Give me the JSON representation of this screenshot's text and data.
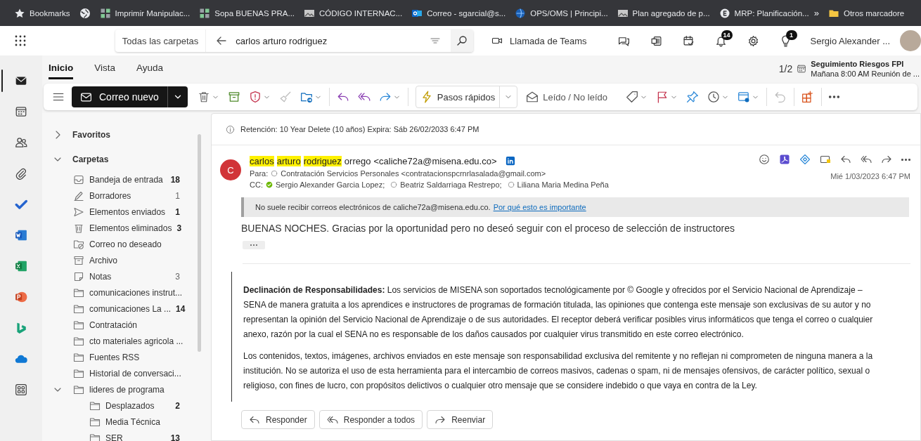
{
  "bookmarks_bar": {
    "items": [
      {
        "label": "Bookmarks"
      },
      {
        "label": "Imprimir Manipulac..."
      },
      {
        "label": "Sopa BUENAS PRA..."
      },
      {
        "label": "CÓDIGO INTERNAC..."
      },
      {
        "label": "Correo - sgarcial@s..."
      },
      {
        "label": "OPS/OMS | Principi..."
      },
      {
        "label": "Plan agregado de p..."
      },
      {
        "label": "MRP: Planificación..."
      }
    ],
    "overflow": "»",
    "other_bookmarks": "Otros marcadore"
  },
  "header": {
    "search": {
      "scope": "Todas las carpetas",
      "query": "carlos arturo rodriguez"
    },
    "teams_call": "Llamada de Teams",
    "notifications_badge": "14",
    "tips_badge": "1",
    "user_name": "Sergio Alexander ..."
  },
  "app_rail": [
    {
      "selected": true
    },
    {
      "selected": false
    },
    {
      "selected": false
    },
    {
      "selected": false
    },
    {
      "selected": false
    },
    {
      "selected": false
    },
    {
      "selected": false
    },
    {
      "selected": false
    },
    {
      "selected": false
    },
    {
      "selected": false
    },
    {
      "selected": false
    }
  ],
  "ribbon": {
    "tabs": [
      {
        "label": "Inicio",
        "selected": true
      },
      {
        "label": "Vista",
        "selected": false
      },
      {
        "label": "Ayuda",
        "selected": false
      }
    ],
    "reminder": {
      "counter": "1/2",
      "title": "Seguimiento Riesgos FPI",
      "subtitle": "Mañana 8:00 AM Reunión de ..."
    }
  },
  "toolbar": {
    "new_mail": "Correo nuevo",
    "quick_steps": "Pasos rápidos",
    "read_unread": "Leído / No leído"
  },
  "folder_pane": {
    "sections": [
      {
        "label": "Favoritos",
        "expanded": false
      },
      {
        "label": "Carpetas",
        "expanded": true,
        "folders": [
          {
            "kind": "inbox",
            "name": "Bandeja de entrada",
            "count": "18",
            "unread": true
          },
          {
            "kind": "drafts",
            "name": "Borradores",
            "count": "1",
            "unread": false
          },
          {
            "kind": "sent",
            "name": "Elementos enviados",
            "count": "1",
            "unread": true
          },
          {
            "kind": "deleted",
            "name": "Elementos eliminados",
            "count": "3",
            "unread": true
          },
          {
            "kind": "junk",
            "name": "Correo no deseado"
          },
          {
            "kind": "archive",
            "name": "Archivo"
          },
          {
            "kind": "notes",
            "name": "Notas",
            "count": "3",
            "unread": false
          },
          {
            "kind": "folder",
            "name": "comunicaciones instrut..."
          },
          {
            "kind": "folder",
            "name": "comunicaciones La ...",
            "count": "14",
            "unread": true
          },
          {
            "kind": "folder",
            "name": "Contratación"
          },
          {
            "kind": "folder",
            "name": "cto materiales agricola ..."
          },
          {
            "kind": "folder",
            "name": "Fuentes RSS"
          },
          {
            "kind": "folder",
            "name": "Historial de conversaci..."
          },
          {
            "kind": "folder",
            "name": "lideres de programa",
            "expanded": true,
            "children": [
              {
                "kind": "folder",
                "name": "Desplazados",
                "count": "2",
                "unread": true
              },
              {
                "kind": "folder",
                "name": "Media Técnica"
              },
              {
                "kind": "folder",
                "name": "SER",
                "count": "13",
                "unread": true
              }
            ]
          }
        ]
      }
    ]
  },
  "message": {
    "retention": "Retención: 10 Year Delete (10 años) Expira: Sáb 26/02/2033 6:47 PM",
    "avatar_initial": "C",
    "sender_parts": [
      {
        "text": "carlos",
        "highlighted": true
      },
      {
        "text": "arturo",
        "highlighted": true
      },
      {
        "text": "rodriguez",
        "highlighted": true
      },
      {
        "text": "orrego",
        "highlighted": false
      }
    ],
    "sender_email": "<caliche72a@misena.edu.co>",
    "to_label": "Para:",
    "to": [
      {
        "name": "Contratación Servicios Personales <contratacionspcrnrlasalada@gmail.com>",
        "online": false
      }
    ],
    "cc_label": "CC:",
    "cc": [
      {
        "name": "Sergio Alexander Garcia Lopez;",
        "online": true
      },
      {
        "name": "Beatriz Saldarriaga Restrepo;",
        "online": false
      },
      {
        "name": "Liliana Maria Medina Peña",
        "online": false
      }
    ],
    "date": "Mié 1/03/2023 6:47 PM",
    "notice": {
      "text": "No suele recibir correos electrónicos de caliche72a@misena.edu.co.",
      "link": "Por qué esto es importante"
    },
    "body": "BUENAS NOCHES. Gracias por la oportunidad pero no deseó seguir con el proceso de selección de instructores",
    "disclaimer": [
      "**Declinación de Responsabilidades:** Los servicios de MISENA son soportados tecnológicamente por © Google y ofrecidos por el Servicio Nacional de Aprendizaje – SENA de manera gratuita a los aprendices e instructores de programas de formación titulada, las opiniones que contenga este mensaje son exclusivas de su autor y no representan la opinión del Servicio Nacional de Aprendizaje o de sus autoridades. El receptor deberá verificar posibles virus informáticos que tenga el correo o cualquier anexo, razón por la cual el SENA no es responsable de los daños causados por cualquier virus transmitido en este correo electrónico.",
      "Los contenidos, textos, imágenes, archivos enviados en este mensaje son responsabilidad exclusiva del remitente y no reflejan ni comprometen de ninguna manera a la institución. No se autoriza el uso de esta herramienta para el intercambio de correos masivos, cadenas o spam, ni de mensajes ofensivos, de carácter político, sexual o religioso, con fines de lucro, con propósitos delictivos o cualquier otro mensaje que se considere indebido o que vaya en contra de la Ley."
    ],
    "actions": [
      {
        "kind": "reply",
        "label": "Responder"
      },
      {
        "kind": "reply-all",
        "label": "Responder a todos"
      },
      {
        "kind": "forward",
        "label": "Reenviar"
      }
    ]
  }
}
